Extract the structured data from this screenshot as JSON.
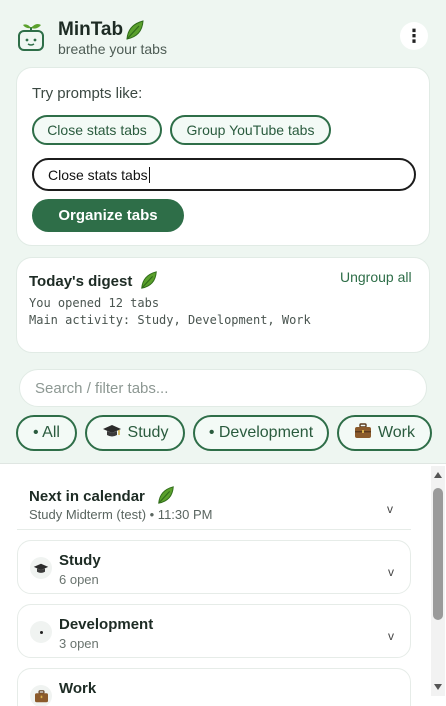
{
  "header": {
    "title": "MinTab",
    "tagline": "breathe your tabs",
    "menu_glyph": "⋮",
    "logo_icon": "seedling-face-icon",
    "title_icon": "leaf-icon"
  },
  "prompt_panel": {
    "try_label": "Try prompts like:",
    "suggestions": [
      "Close stats tabs",
      "Group YouTube tabs"
    ],
    "input_value": "Close stats tabs",
    "organize_label": "Organize tabs"
  },
  "digest": {
    "title": "Today's digest",
    "ungroup_label": "Ungroup all",
    "line1": "You opened 12 tabs",
    "line2": "Main activity: Study, Development, Work"
  },
  "search": {
    "placeholder": "Search / filter tabs..."
  },
  "filters": [
    {
      "label": "• All",
      "icon": ""
    },
    {
      "label": "Study",
      "icon": "graduation-cap-icon"
    },
    {
      "label": "• Development",
      "icon": ""
    },
    {
      "label": "Work",
      "icon": "briefcase-icon"
    }
  ],
  "calendar": {
    "title": "Next in calendar",
    "event": "Study Midterm (test) • 11:30 PM",
    "chevron": "v"
  },
  "groups": [
    {
      "name": "Study",
      "count": "6 open",
      "icon": "graduation-cap-icon"
    },
    {
      "name": "Development",
      "count": "3 open",
      "icon": "dot-icon"
    },
    {
      "name": "Work",
      "count": "",
      "icon": "briefcase-icon"
    }
  ],
  "colors": {
    "accent": "#2e6e48",
    "panel_background": "#eef6f1",
    "leaf": "#5aa02c"
  }
}
